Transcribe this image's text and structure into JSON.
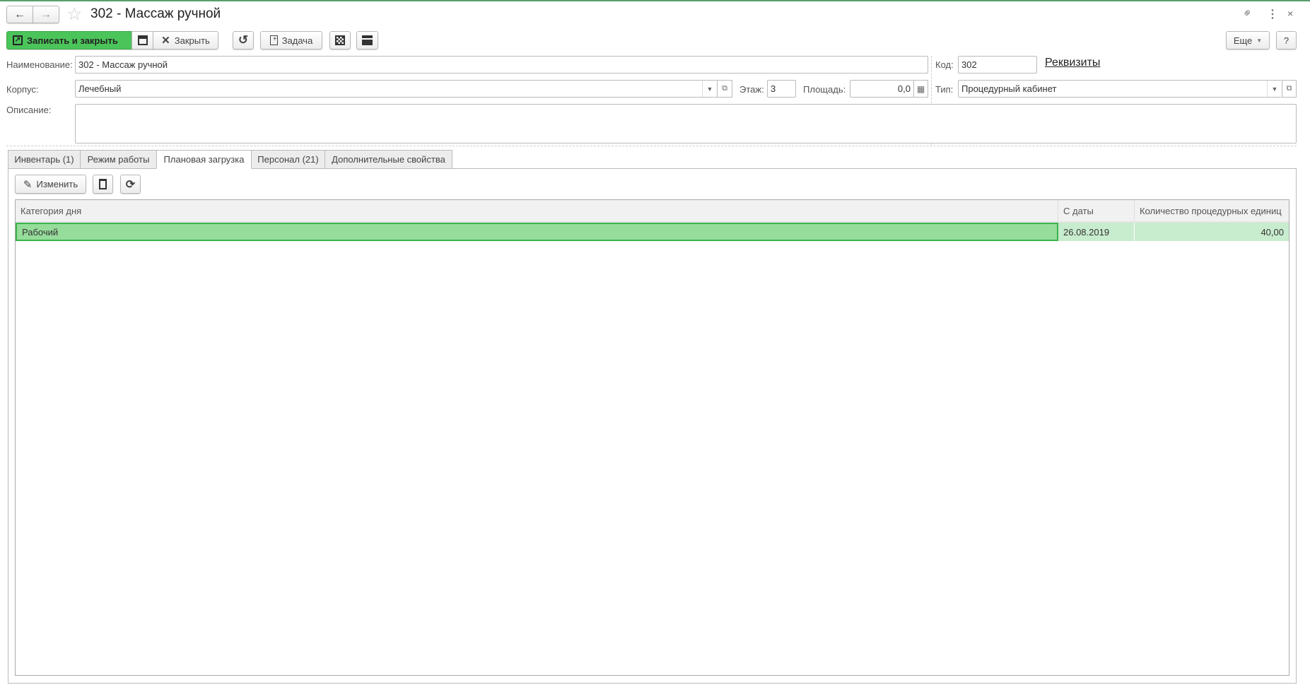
{
  "window": {
    "title": "302 - Массаж ручной",
    "icons": [
      "back-arrow-icon",
      "forward-arrow-icon",
      "star-icon",
      "link-icon",
      "more-icon",
      "close-icon"
    ]
  },
  "toolbar": {
    "save_close": "Записать и закрыть",
    "close": "Закрыть",
    "task": "Задача",
    "more": "Еще",
    "help": "?"
  },
  "form": {
    "name_label": "Наименование:",
    "name_value": "302 - Массаж ручной",
    "code_label": "Код:",
    "code_value": "302",
    "details_link": "Реквизиты",
    "building_label": "Корпус:",
    "building_value": "Лечебный",
    "floor_label": "Этаж:",
    "floor_value": "3",
    "area_label": "Площадь:",
    "area_value": "0,0",
    "type_label": "Тип:",
    "type_value": "Процедурный кабинет",
    "description_label": "Описание:",
    "description_value": ""
  },
  "tabs": [
    {
      "label": "Инвентарь (1)"
    },
    {
      "label": "Режим работы"
    },
    {
      "label": "Плановая загрузка"
    },
    {
      "label": "Персонал (21)"
    },
    {
      "label": "Дополнительные свойства"
    }
  ],
  "active_tab": "Плановая загрузка",
  "panel": {
    "edit": "Изменить"
  },
  "table": {
    "columns": [
      "Категория дня",
      "С даты",
      "Количество процедурных единиц"
    ],
    "rows": [
      {
        "category": "Рабочий",
        "date": "26.08.2019",
        "units": "40,00"
      }
    ]
  },
  "colors": {
    "accent": "#4bc45a",
    "selected_row": "#96dc9b",
    "selected_row_light": "#c8ecce"
  }
}
